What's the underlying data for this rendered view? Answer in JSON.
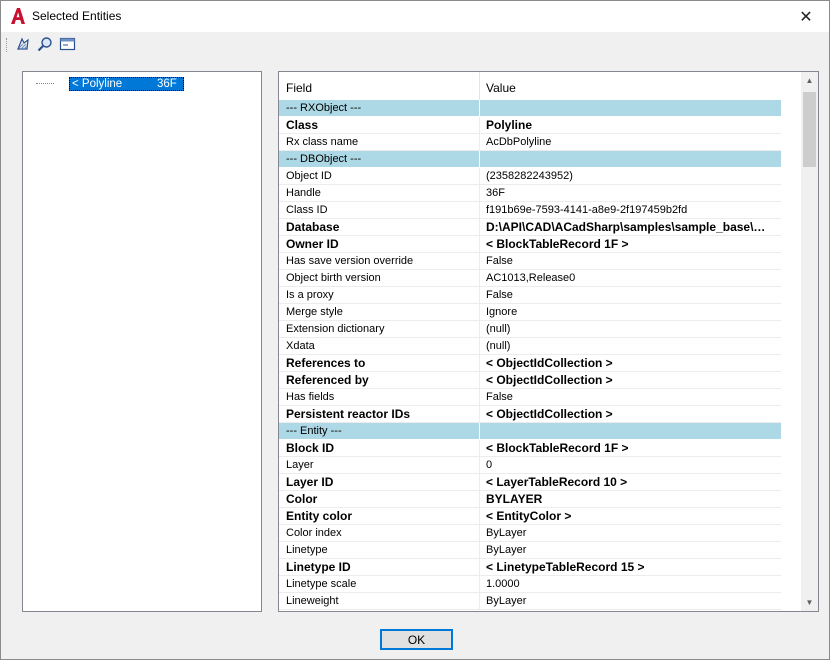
{
  "window": {
    "title": "Selected Entities",
    "close_glyph": "✕",
    "app_icon": "autocad-a-icon",
    "accent": "#c8102e"
  },
  "toolbar": {
    "icons": [
      "grip-icon",
      "hatch-entities-icon",
      "zoom-entities-icon",
      "window-select-icon"
    ]
  },
  "tree": {
    "node_name": "< Polyline",
    "node_handle": "36F >"
  },
  "grid": {
    "header": {
      "field": "Field",
      "value": "Value"
    },
    "section_color": "#add8e6",
    "rows": [
      {
        "type": "section",
        "field": "--- RXObject ---",
        "value": ""
      },
      {
        "type": "bold",
        "field": "Class",
        "value": " Polyline"
      },
      {
        "type": "normal",
        "field": "Rx class name",
        "value": "AcDbPolyline"
      },
      {
        "type": "section",
        "field": "--- DBObject ---",
        "value": ""
      },
      {
        "type": "normal",
        "field": "Object ID",
        "value": "(2358282243952)"
      },
      {
        "type": "normal",
        "field": "Handle",
        "value": "36F"
      },
      {
        "type": "normal",
        "field": "Class ID",
        "value": "f191b69e-7593-4141-a8e9-2f197459b2fd"
      },
      {
        "type": "bold",
        "field": "Database",
        "value": "D:\\API\\CAD\\ACadSharp\\samples\\sample_base\\…"
      },
      {
        "type": "bold",
        "field": "Owner ID",
        "value": "< BlockTableRecord        1F >"
      },
      {
        "type": "normal",
        "field": "Has save version override",
        "value": "False"
      },
      {
        "type": "normal",
        "field": "Object birth version",
        "value": "AC1013,Release0"
      },
      {
        "type": "normal",
        "field": "Is a proxy",
        "value": "False"
      },
      {
        "type": "normal",
        "field": "Merge style",
        "value": "Ignore"
      },
      {
        "type": "normal",
        "field": "Extension dictionary",
        "value": "(null)"
      },
      {
        "type": "normal",
        "field": "Xdata",
        "value": "(null)"
      },
      {
        "type": "bold",
        "field": "References to",
        "value": "< ObjectIdCollection >"
      },
      {
        "type": "bold",
        "field": "Referenced by",
        "value": "< ObjectIdCollection >"
      },
      {
        "type": "normal",
        "field": "Has fields",
        "value": "False"
      },
      {
        "type": "bold",
        "field": "Persistent reactor IDs",
        "value": "< ObjectIdCollection >"
      },
      {
        "type": "section",
        "field": "--- Entity ---",
        "value": ""
      },
      {
        "type": "bold",
        "field": "Block ID",
        "value": "< BlockTableRecord        1F >"
      },
      {
        "type": "normal",
        "field": "Layer",
        "value": "0"
      },
      {
        "type": "bold",
        "field": "Layer ID",
        "value": "< LayerTableRecord        10 >"
      },
      {
        "type": "bold",
        "field": "Color",
        "value": "BYLAYER"
      },
      {
        "type": "bold",
        "field": "Entity color",
        "value": "< EntityColor >"
      },
      {
        "type": "normal",
        "field": "Color index",
        "value": "ByLayer"
      },
      {
        "type": "normal",
        "field": "Linetype",
        "value": "ByLayer"
      },
      {
        "type": "bold",
        "field": "Linetype ID",
        "value": "< LinetypeTableRecord     15 >"
      },
      {
        "type": "normal",
        "field": "Linetype scale",
        "value": "1.0000"
      },
      {
        "type": "normal",
        "field": "Lineweight",
        "value": "ByLayer"
      }
    ]
  },
  "scrollbar": {
    "up_glyph": "▲",
    "down_glyph": "▼"
  },
  "footer": {
    "ok_label": "OK"
  }
}
